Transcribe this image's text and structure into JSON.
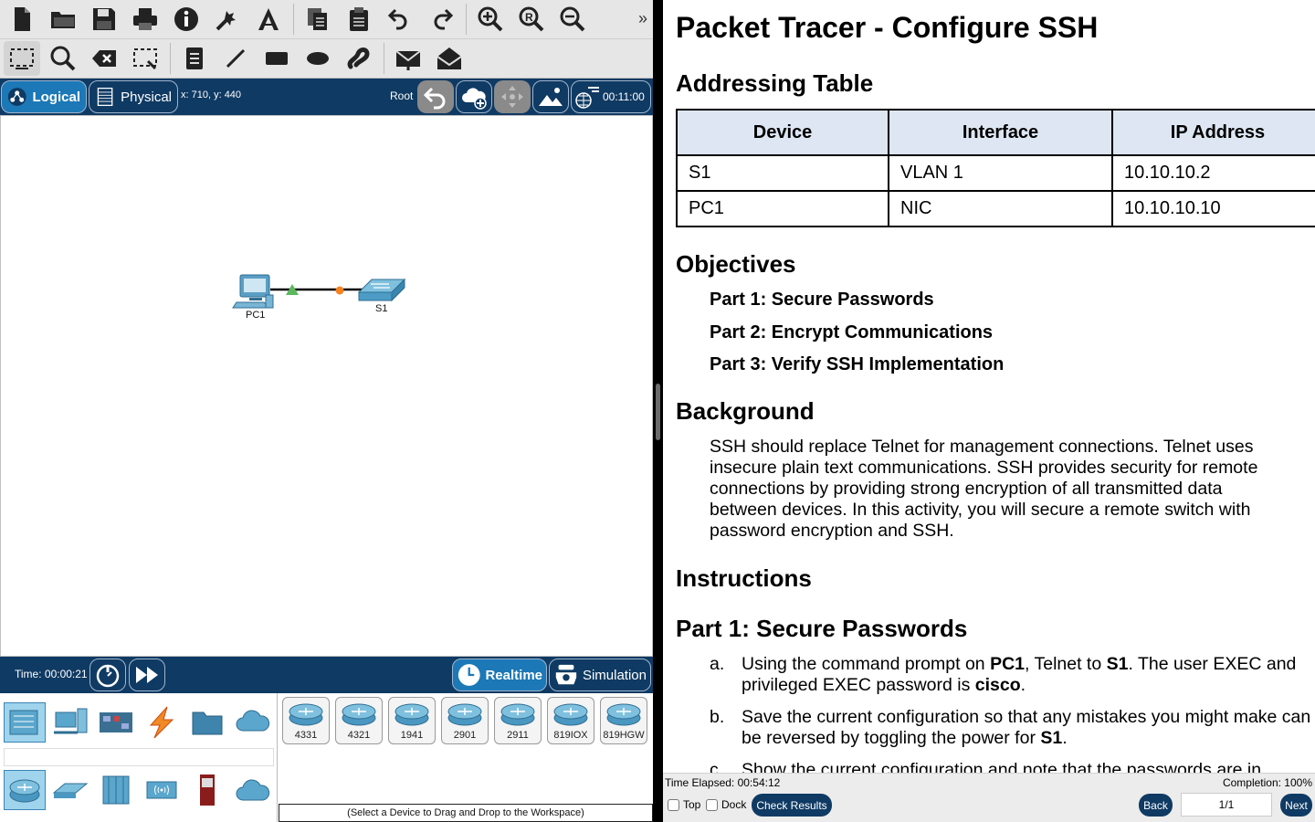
{
  "left": {
    "navbar": {
      "logical_label": "Logical",
      "physical_label": "Physical",
      "coords": "x: 710, y: 440",
      "root_label": "Root",
      "clock": "00:11:00"
    },
    "workspace": {
      "devices": [
        {
          "name": "PC1"
        },
        {
          "name": "S1"
        }
      ]
    },
    "timebar": {
      "time": "Time: 00:00:21",
      "realtime_label": "Realtime",
      "simulation_label": "Simulation"
    },
    "device_panel": {
      "models": [
        "4331",
        "4321",
        "1941",
        "2901",
        "2911",
        "819IOX",
        "819HGW"
      ],
      "hint": "(Select a Device to Drag and Drop to the Workspace)"
    }
  },
  "doc": {
    "title": "Packet Tracer - Configure SSH",
    "addressing_heading": "Addressing Table",
    "table": {
      "headers": [
        "Device",
        "Interface",
        "IP Address"
      ],
      "rows": [
        [
          "S1",
          "VLAN 1",
          "10.10.10.2"
        ],
        [
          "PC1",
          "NIC",
          "10.10.10.10"
        ]
      ]
    },
    "objectives_heading": "Objectives",
    "objectives": [
      "Part 1: Secure Passwords",
      "Part 2: Encrypt Communications",
      "Part 3: Verify SSH Implementation"
    ],
    "background_heading": "Background",
    "background": "SSH should replace Telnet for management connections. Telnet uses insecure plain text communications. SSH provides security for remote connections by providing strong encryption of all transmitted data between devices. In this activity, you will secure a remote switch with password encryption and SSH.",
    "instructions_heading": "Instructions",
    "part1_heading": "Part 1: Secure Passwords",
    "steps": {
      "a": {
        "label": "a.",
        "t1": "Using the command prompt on ",
        "b1": "PC1",
        "t2": ", Telnet to ",
        "b2": "S1",
        "t3": ". The user EXEC and privileged EXEC password is ",
        "b3": "cisco",
        "t4": "."
      },
      "b": {
        "label": "b.",
        "t1": "Save the current configuration so that any mistakes you might make can be reversed by toggling the power for ",
        "b1": "S1",
        "t2": "."
      },
      "c": {
        "label": "c.",
        "t1": "Show the current configuration and note that the passwords are in"
      }
    }
  },
  "status": {
    "elapsed": "Time Elapsed: 00:54:12",
    "completion": "Completion: 100%",
    "top_label": "Top",
    "dock_label": "Dock",
    "check_results": "Check Results",
    "back": "Back",
    "page": "1/1",
    "next": "Next"
  },
  "colors": {
    "nav_bg": "#0f3a63",
    "active_tab": "#1c78b6",
    "table_header": "#dde6f2",
    "link_green": "#5cb85c",
    "link_orange": "#f58220"
  }
}
